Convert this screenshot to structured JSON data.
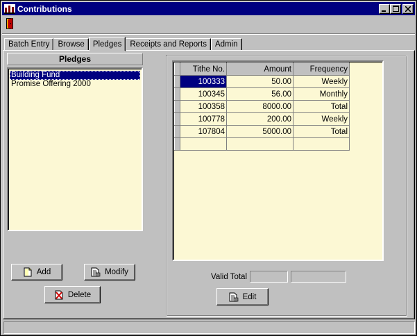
{
  "window": {
    "title": "Contributions"
  },
  "title_controls": {
    "minimize": "_",
    "maximize": "□",
    "close": "✕"
  },
  "tabs": [
    {
      "label": "Batch Entry",
      "active": false
    },
    {
      "label": "Browse",
      "active": false
    },
    {
      "label": "Pledges",
      "active": true
    },
    {
      "label": "Receipts and Reports",
      "active": false
    },
    {
      "label": "Admin",
      "active": false
    }
  ],
  "pledges": {
    "header": "Pledges",
    "items": [
      "Building Fund",
      "Promise Offering 2000"
    ],
    "selected": "Building Fund",
    "buttons": {
      "add": "Add",
      "modify": "Modify",
      "delete": "Delete"
    }
  },
  "grid": {
    "columns": [
      "Tithe No.",
      "Amount",
      "Frequency"
    ],
    "rows": [
      [
        "100333",
        "50.00",
        "Weekly"
      ],
      [
        "100345",
        "56.00",
        "Monthly"
      ],
      [
        "100358",
        "8000.00",
        "Total"
      ],
      [
        "100778",
        "200.00",
        "Weekly"
      ],
      [
        "107804",
        "5000.00",
        "Total"
      ]
    ]
  },
  "valid_total": {
    "label": "Valid Total",
    "value1": "",
    "value2": ""
  },
  "edit_button": "Edit",
  "colors": {
    "titlebar": "#000080",
    "list_bg": "#fcf8d4",
    "face": "#c0c0c0"
  },
  "icons": [
    "app-icon",
    "exit-door-icon",
    "add-page-icon",
    "modify-page-icon",
    "delete-page-icon",
    "edit-page-icon"
  ]
}
